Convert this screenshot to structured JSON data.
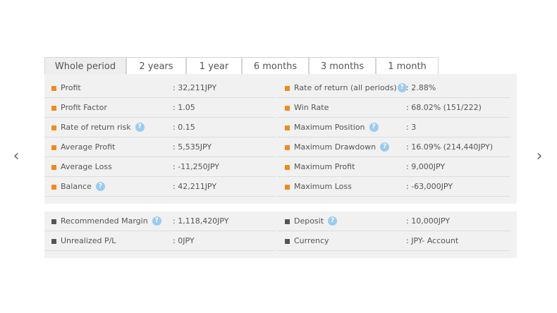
{
  "nav": {
    "prev_glyph": "‹",
    "next_glyph": "›"
  },
  "tabs": [
    {
      "label": "Whole period",
      "active": true
    },
    {
      "label": "2 years",
      "active": false
    },
    {
      "label": "1 year",
      "active": false
    },
    {
      "label": "6 months",
      "active": false
    },
    {
      "label": "3 months",
      "active": false
    },
    {
      "label": "1 month",
      "active": false
    }
  ],
  "help_glyph": "?",
  "summary": {
    "left": [
      {
        "label": "Profit",
        "value": ": 32,211JPY",
        "help": false
      },
      {
        "label": "Profit Factor",
        "value": ": 1.05",
        "help": false
      },
      {
        "label": "Rate of return risk",
        "value": ": 0.15",
        "help": true
      },
      {
        "label": "Average Profit",
        "value": ": 5,535JPY",
        "help": false
      },
      {
        "label": "Average Loss",
        "value": ": -11,250JPY",
        "help": false
      },
      {
        "label": "Balance",
        "value": ": 42,211JPY",
        "help": true
      }
    ],
    "right": [
      {
        "label": "Rate of return (all periods)",
        "value": ": 2.88%",
        "help": true
      },
      {
        "label": "Win Rate",
        "value": ": 68.02% (151/222)",
        "help": false
      },
      {
        "label": "Maximum Position",
        "value": ": 3",
        "help": true
      },
      {
        "label": "Maximum Drawdown",
        "value": ": 16.09% (214,440JPY)",
        "help": true
      },
      {
        "label": "Maximum Profit",
        "value": ": 9,000JPY",
        "help": false
      },
      {
        "label": "Maximum Loss",
        "value": ": -63,000JPY",
        "help": false
      }
    ]
  },
  "account": {
    "left": [
      {
        "label": "Recommended Margin",
        "value": ": 1,118,420JPY",
        "help": true
      },
      {
        "label": "Unrealized P/L",
        "value": ": 0JPY",
        "help": false
      }
    ],
    "right": [
      {
        "label": "Deposit",
        "value": ": 10,000JPY",
        "help": true
      },
      {
        "label": "Currency",
        "value": ": JPY- Account",
        "help": false
      }
    ]
  },
  "colors": {
    "bullet_orange": "#f08a1c",
    "bullet_gray": "#555555",
    "help_blue": "#9ccbef",
    "panel_bg": "#f1f1f1"
  }
}
